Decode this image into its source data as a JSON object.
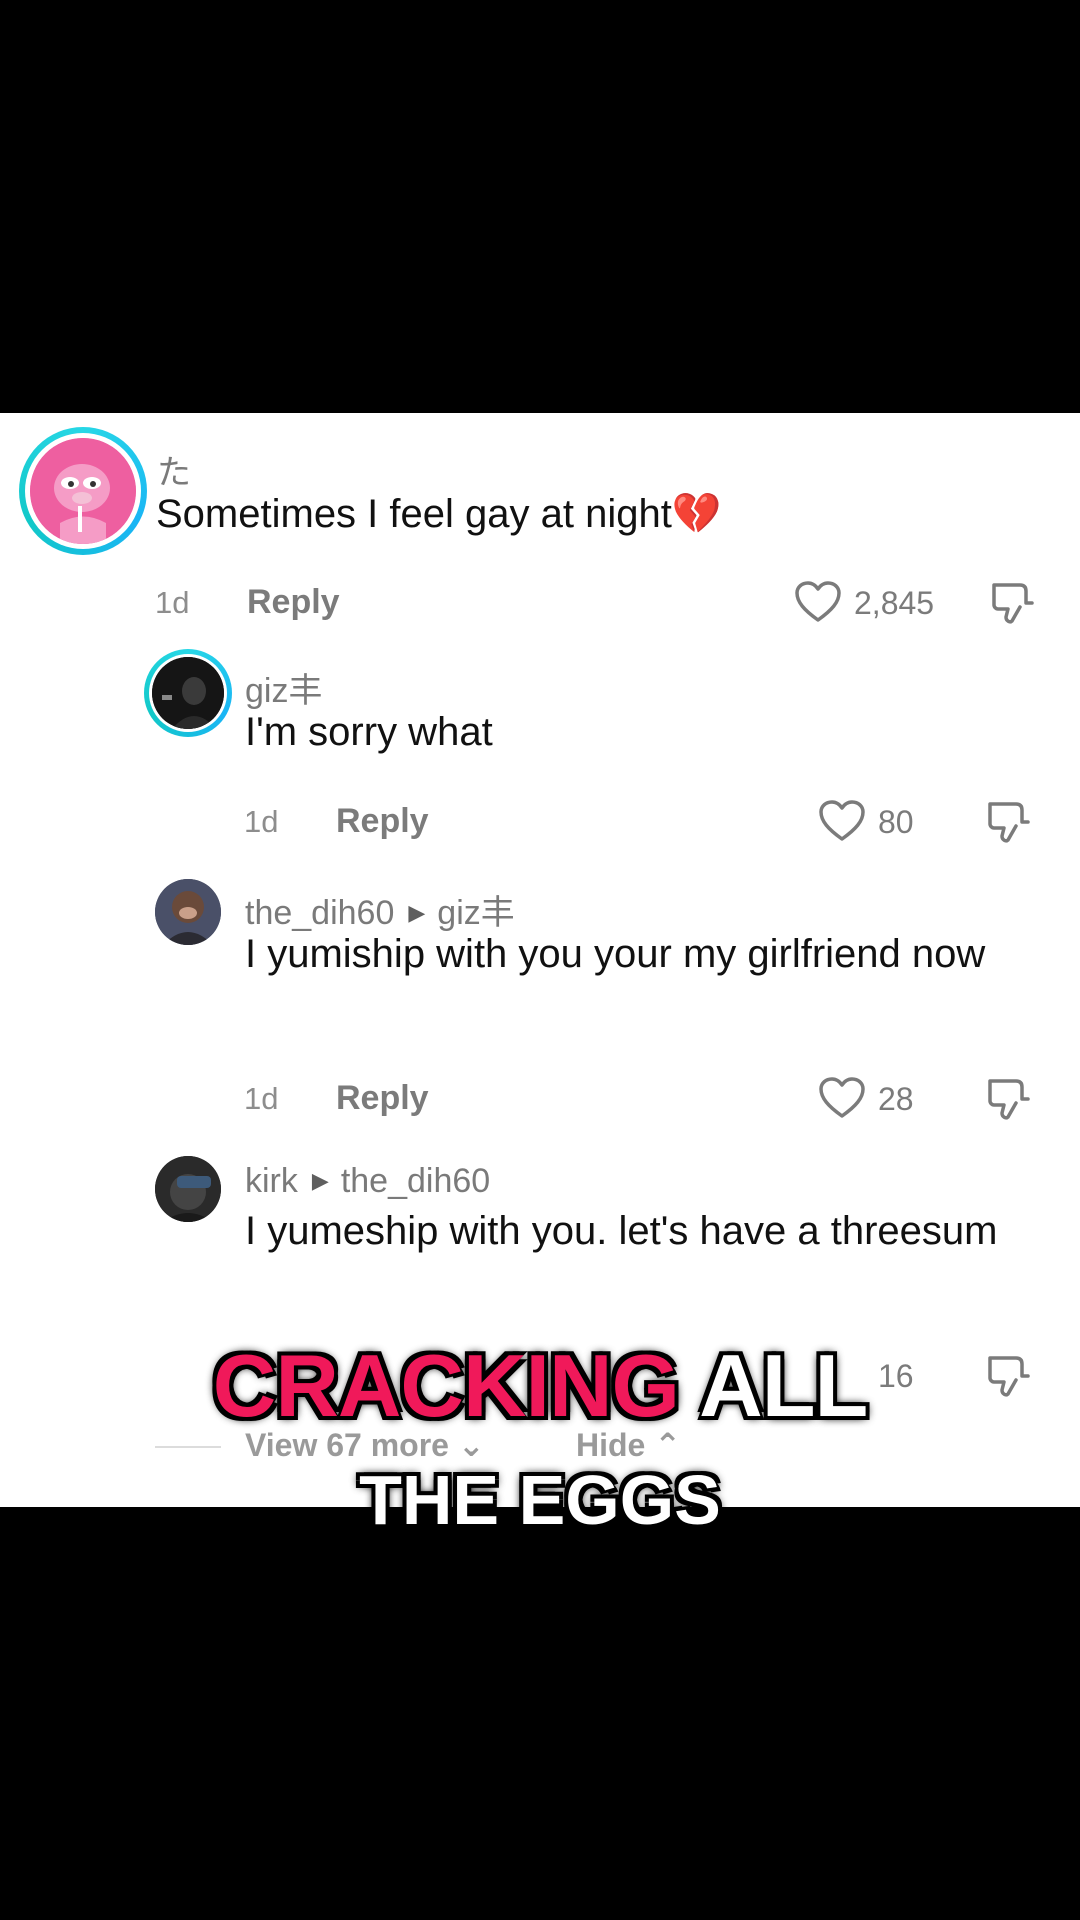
{
  "comments": [
    {
      "username": "た",
      "text": "Sometimes I feel gay at night💔",
      "time": "1d",
      "reply_label": "Reply",
      "likes": "2,845",
      "avatar_icon": "pink-panther-avatar"
    },
    {
      "username": "giz丰",
      "text": "I'm sorry what",
      "time": "1d",
      "reply_label": "Reply",
      "likes": "80",
      "avatar_icon": "dark-avatar"
    },
    {
      "username": "the_dih60",
      "reply_to": "giz丰",
      "text": "I yumiship with you your my girlfriend now",
      "time": "1d",
      "reply_label": "Reply",
      "likes": "28",
      "avatar_icon": "gorilla-avatar"
    },
    {
      "username": "kirk",
      "reply_to": "the_dih60",
      "text": "I yumeship with you. let's have a threesum",
      "likes": "16",
      "avatar_icon": "cap-avatar"
    }
  ],
  "thread": {
    "view_more_label": "View 67 more",
    "hide_label": "Hide"
  },
  "caption": {
    "hot_word": "CRACKING",
    "rest_word": "ALL",
    "line2": "THE EGGS"
  },
  "colors": {
    "caption_pink": "#f0195a",
    "story_ring": "#27d7e6"
  }
}
